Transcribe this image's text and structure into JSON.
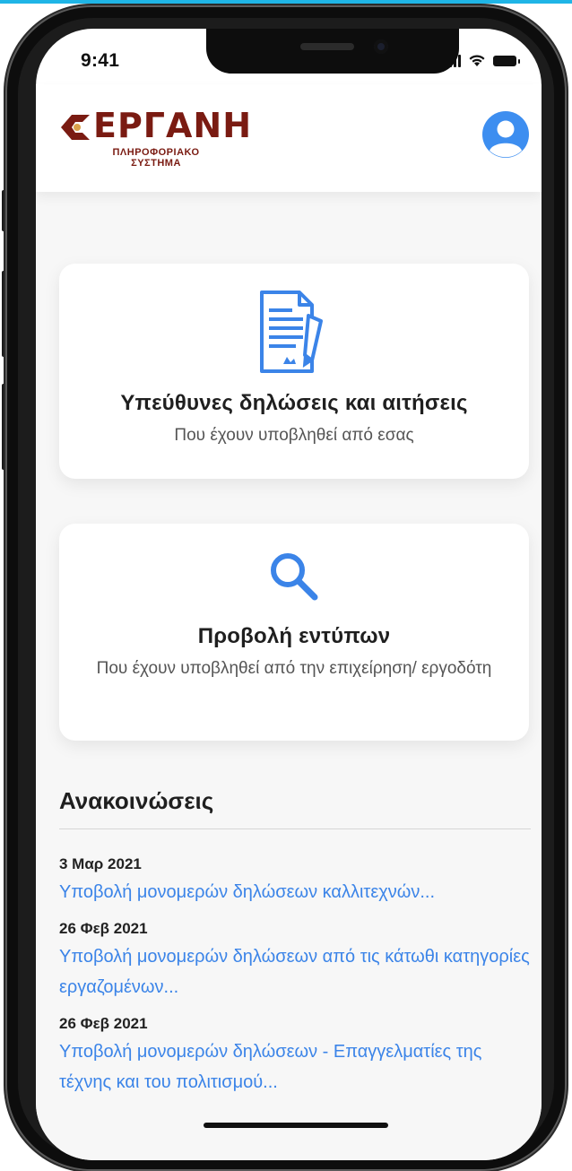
{
  "status_bar": {
    "time": "9:41"
  },
  "header": {
    "logo_text": "ΕΡΓΑΝΗ",
    "logo_sub_line1": "ΠΛΗΡΟΦΟΡΙΑΚΟ",
    "logo_sub_line2": "ΣΥΣΤΗΜΑ",
    "profile_icon": "user-circle-icon"
  },
  "cards": [
    {
      "icon": "document-signature-icon",
      "title": "Υπεύθυνες δηλώσεις και αιτήσεις",
      "subtitle": "Που έχουν υποβληθεί από εσας"
    },
    {
      "icon": "search-icon",
      "title": "Προβολή εντύπων",
      "subtitle": "Που έχουν υποβληθεί από την επιχείρηση/ εργοδότη"
    }
  ],
  "announcements": {
    "heading": "Ανακοινώσεις",
    "items": [
      {
        "date": "3 Μαρ 2021",
        "text": "Υποβολή μονομερών δηλώσεων καλλιτεχνών..."
      },
      {
        "date": "26 Φεβ 2021",
        "text": "Υποβολή μονομερών δηλώσεων από τις κάτωθι κατηγορίες εργαζομένων..."
      },
      {
        "date": "26 Φεβ 2021",
        "text": "Υποβολή μονομερών δηλώσεων - Επαγγελματίες της τέχνης και του πολιτισμού..."
      }
    ]
  },
  "colors": {
    "accent": "#3b84e8",
    "logo": "#7a1b12",
    "avatar": "#3d8ef0"
  }
}
